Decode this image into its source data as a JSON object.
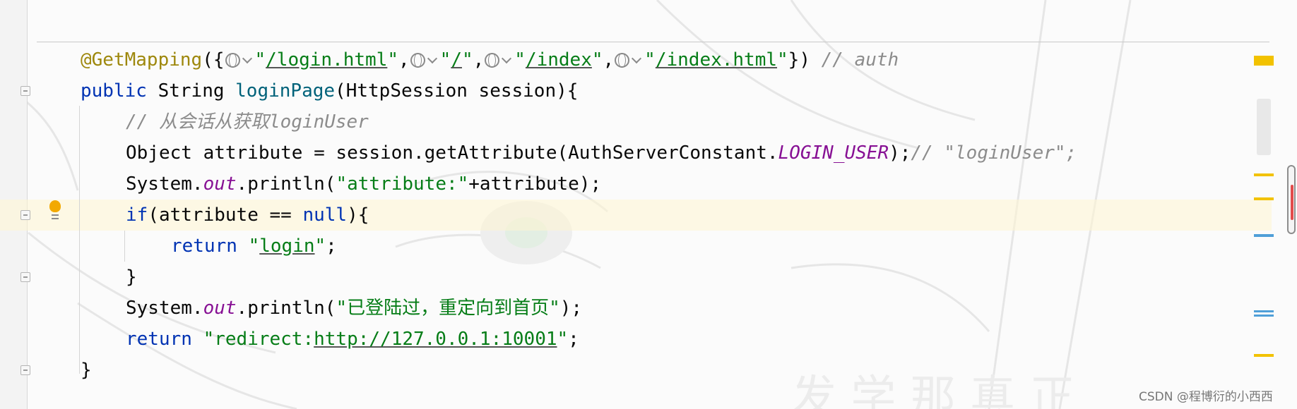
{
  "code_lines": [
    {
      "tokens": {
        "annotation": "@GetMapping",
        "open": "({",
        "url1": "/login.html",
        "url2": "/",
        "url3": "/index",
        "url4": "/index.html",
        "close": "})",
        "comment": "// auth"
      }
    },
    {
      "tokens": {
        "kw_public": "public",
        "type": "String",
        "method": "loginPage",
        "params": "(HttpSession session){"
      }
    },
    {
      "tokens": {
        "comment": "// 从会话从获取loginUser"
      }
    },
    {
      "tokens": {
        "pre": "Object attribute = session.getAttribute(AuthServerConstant.",
        "constant": "LOGIN_USER",
        "post": ");",
        "comment": "// \"loginUser\";"
      }
    },
    {
      "tokens": {
        "system": "System.",
        "out": "out",
        "println": ".println(",
        "str": "\"attribute:\"",
        "rest": "+attribute);"
      }
    },
    {
      "tokens": {
        "kw_if": "if",
        "cond": "(attribute == ",
        "kw_null": "null",
        "end": "){"
      }
    },
    {
      "tokens": {
        "kw_return": "return",
        "str_open": "\"",
        "str_link": "login",
        "str_close": "\"",
        "semi": ";"
      }
    },
    {
      "tokens": {
        "brace": "}"
      }
    },
    {
      "tokens": {
        "system": "System.",
        "out": "out",
        "println": ".println(",
        "str": "\"已登陆过，重定向到首页\"",
        "rest": ");"
      }
    },
    {
      "tokens": {
        "kw_return": "return",
        "str_prefix": "\"redirect:",
        "str_link": "http://127.0.0.1:10001",
        "str_close": "\"",
        "semi": ";"
      }
    },
    {
      "tokens": {
        "brace": "}"
      }
    }
  ],
  "icons": {
    "url_link": "globe-icon",
    "url_dropdown": "chevron-down-icon",
    "intention": "lightbulb-icon",
    "fold": "fold-marker-icon"
  },
  "watermark": "CSDN @程博衍的小西西",
  "colors": {
    "keyword": "#0033b3",
    "annotation": "#9e880d",
    "method": "#00627a",
    "string": "#067d17",
    "comment": "#8c8c8c",
    "static_field": "#871094",
    "current_line": "#fff6d2",
    "warning_mark": "#f2c200",
    "info_mark": "#4f9fd8",
    "error_mark": "#e34b4b"
  }
}
